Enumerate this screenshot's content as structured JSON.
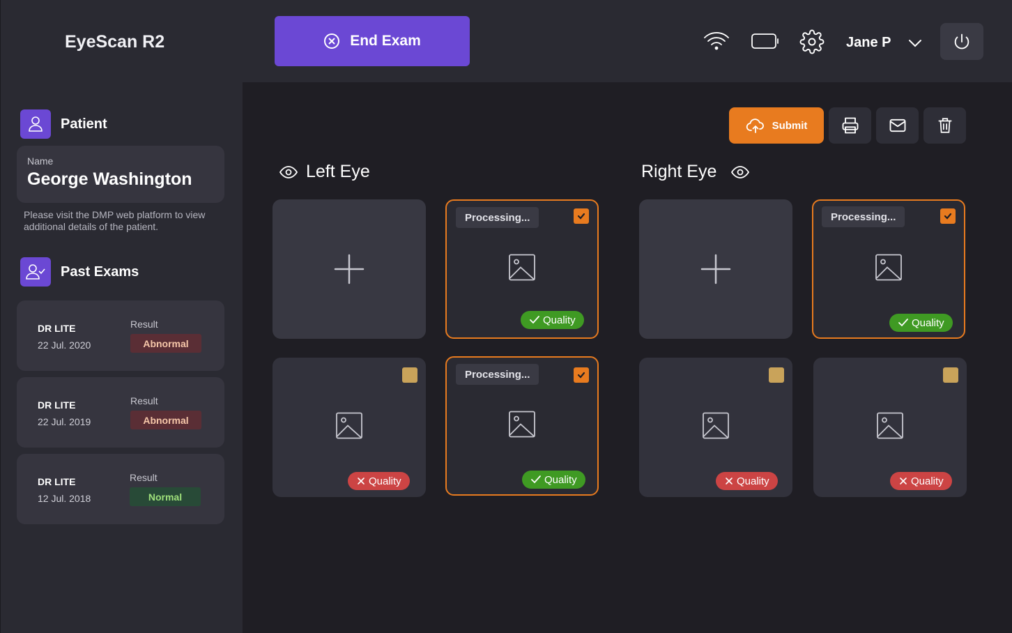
{
  "app": {
    "title": "EyeScan R2"
  },
  "patient": {
    "heading": "Patient",
    "name_label": "Name",
    "name": "George Washington",
    "note": "Please visit the DMP web platform to view additional details of the patient."
  },
  "past_exams": {
    "heading": "Past Exams",
    "items": [
      {
        "name": "DR LITE",
        "date": "22 Jul. 2020",
        "result_label": "Result",
        "result": "Abnormal",
        "status": "abnormal"
      },
      {
        "name": "DR LITE",
        "date": "22 Jul. 2019",
        "result_label": "Result",
        "result": "Abnormal",
        "status": "abnormal"
      },
      {
        "name": "DR LITE",
        "date": "12 Jul. 2018",
        "result_label": "Result",
        "result": "Normal",
        "status": "normal"
      }
    ]
  },
  "topbar": {
    "end_exam_label": "End Exam",
    "user_name": "Jane P",
    "icons": [
      "wifi-icon",
      "battery-icon",
      "gear-icon",
      "chevron-down-icon",
      "power-icon"
    ]
  },
  "actions": {
    "submit_label": "Submit",
    "icons": [
      "print-icon",
      "mail-icon",
      "trash-icon"
    ]
  },
  "left_eye": {
    "heading": "Left Eye",
    "tiles": [
      {
        "kind": "add"
      },
      {
        "kind": "image",
        "selected": true,
        "processing": "Processing...",
        "checked": true,
        "quality": "Quality",
        "quality_ok": true
      },
      {
        "kind": "image",
        "selected": false,
        "checked": false,
        "quality": "Quality",
        "quality_ok": false
      },
      {
        "kind": "image",
        "selected": true,
        "processing": "Processing...",
        "checked": true,
        "quality": "Quality",
        "quality_ok": true
      }
    ]
  },
  "right_eye": {
    "heading": "Right Eye",
    "tiles": [
      {
        "kind": "add"
      },
      {
        "kind": "image",
        "selected": true,
        "processing": "Processing...",
        "checked": true,
        "quality": "Quality",
        "quality_ok": true
      },
      {
        "kind": "image",
        "selected": false,
        "checked": false,
        "quality": "Quality",
        "quality_ok": false
      },
      {
        "kind": "image",
        "selected": false,
        "checked": false,
        "quality": "Quality",
        "quality_ok": false
      }
    ]
  },
  "colors": {
    "accent_purple": "#6b48d4",
    "accent_orange": "#e87b1f",
    "quality_good": "#3f9a23",
    "quality_bad": "#cc4444",
    "abnormal_bg": "#5a2e35",
    "normal_bg": "#284a37"
  }
}
